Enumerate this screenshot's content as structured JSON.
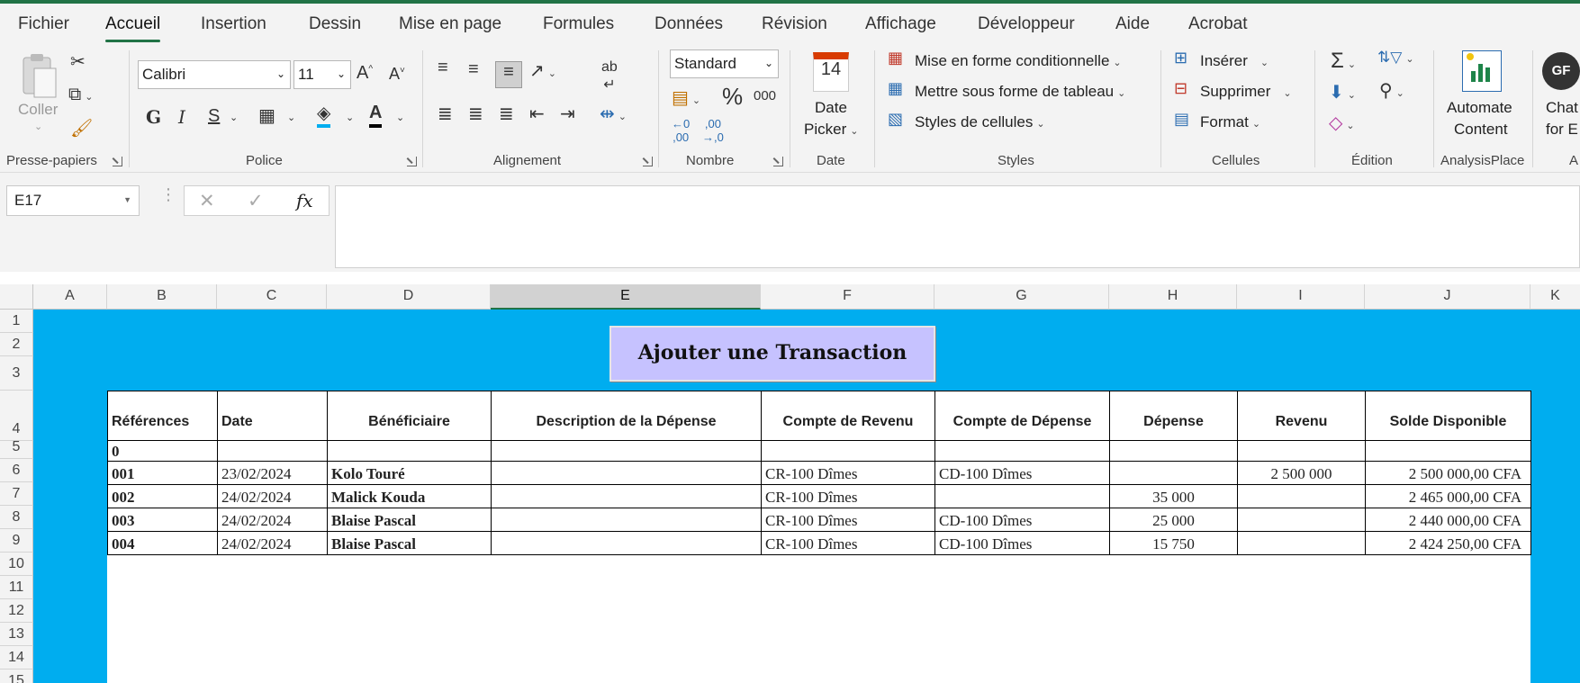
{
  "tabs": [
    "Fichier",
    "Accueil",
    "Insertion",
    "Dessin",
    "Mise en page",
    "Formules",
    "Données",
    "Révision",
    "Affichage",
    "Développeur",
    "Aide",
    "Acrobat"
  ],
  "ribbon": {
    "clipboard": {
      "paste_label": "Coller",
      "group_label": "Presse-papiers"
    },
    "font": {
      "name": "Calibri",
      "size": "11",
      "bold": "G",
      "italic": "I",
      "underline": "S",
      "group_label": "Police"
    },
    "alignment": {
      "group_label": "Alignement"
    },
    "number": {
      "format": "Standard",
      "percent": "%",
      "thousands": "000",
      "group_label": "Nombre"
    },
    "date": {
      "picker_line1": "Date",
      "picker_line2": "Picker",
      "calendar_day": "14",
      "group_label": "Date"
    },
    "styles": {
      "conditional": "Mise en forme conditionnelle",
      "as_table": "Mettre sous forme de tableau",
      "cell_styles": "Styles de cellules",
      "group_label": "Styles"
    },
    "cells": {
      "insert": "Insérer",
      "delete": "Supprimer",
      "format": "Format",
      "group_label": "Cellules"
    },
    "editing": {
      "group_label": "Édition"
    },
    "analysisplace": {
      "line1": "Automate",
      "line2": "Content",
      "group_label": "AnalysisPlace"
    },
    "chat": {
      "line1": "Chat",
      "line2": "for E",
      "avatar": "GF",
      "group_label": "A"
    }
  },
  "formula_bar": {
    "name_box": "E17",
    "fx": "fx",
    "value": ""
  },
  "columns": [
    "A",
    "B",
    "C",
    "D",
    "E",
    "F",
    "G",
    "H",
    "I",
    "J",
    "K"
  ],
  "rows": [
    "1",
    "2",
    "3",
    "4",
    "5",
    "6",
    "7",
    "8",
    "9",
    "10",
    "11",
    "12",
    "13",
    "14",
    "15"
  ],
  "sheet": {
    "button_label": "Ajouter une Transaction",
    "headers": [
      "Références",
      "Date",
      "Bénéficiaire",
      "Description de la Dépense",
      "Compte de Revenu",
      "Compte de Dépense",
      "Dépense",
      "Revenu",
      "Solde Disponible"
    ],
    "rows": [
      [
        "0",
        "",
        "",
        "",
        "",
        "",
        "",
        "",
        ""
      ],
      [
        "001",
        "23/02/2024",
        "Kolo Touré",
        "",
        "CR-100 Dîmes",
        "CD-100 Dîmes",
        "",
        "2 500 000",
        "2 500 000,00 CFA"
      ],
      [
        "002",
        "24/02/2024",
        "Malick Kouda",
        "",
        "CR-100 Dîmes",
        "",
        "35 000",
        "",
        "2 465 000,00 CFA"
      ],
      [
        "003",
        "24/02/2024",
        "Blaise Pascal",
        "",
        "CR-100 Dîmes",
        "CD-100 Dîmes",
        "25 000",
        "",
        "2 440 000,00 CFA"
      ],
      [
        "004",
        "24/02/2024",
        "Blaise Pascal",
        "",
        "CR-100 Dîmes",
        "CD-100 Dîmes",
        "15 750",
        "",
        "2 424 250,00 CFA"
      ]
    ]
  },
  "colors": {
    "accent": "#217346",
    "sheet_background": "#00adef",
    "button": "#c6c2ff"
  }
}
